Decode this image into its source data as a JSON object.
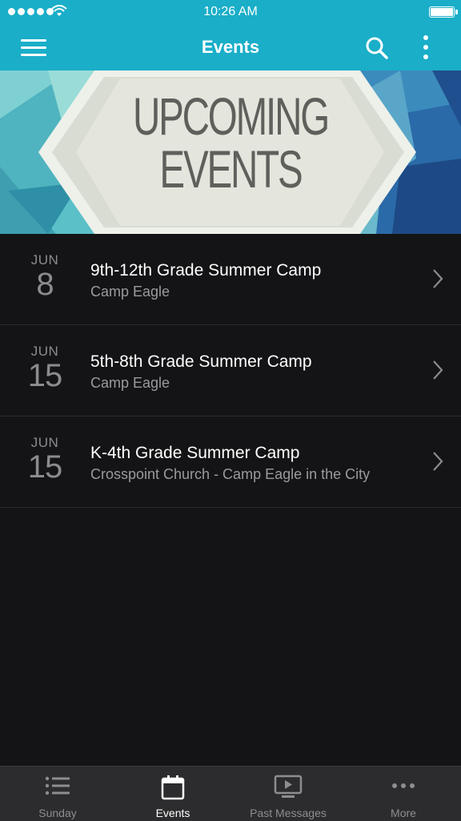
{
  "status_bar": {
    "time": "10:26 AM"
  },
  "nav": {
    "title": "Events"
  },
  "banner": {
    "line1": "UPCOMING",
    "line2": "EVENTS"
  },
  "events": [
    {
      "month": "JUN",
      "day": "8",
      "title": "9th-12th Grade Summer Camp",
      "location": "Camp Eagle"
    },
    {
      "month": "JUN",
      "day": "15",
      "title": "5th-8th Grade Summer Camp",
      "location": "Camp Eagle"
    },
    {
      "month": "JUN",
      "day": "15",
      "title": "K-4th Grade Summer Camp",
      "location": "Crosspoint Church - Camp Eagle in the City"
    }
  ],
  "tabs": [
    {
      "label": "Sunday",
      "icon": "list-icon"
    },
    {
      "label": "Events",
      "icon": "calendar-icon",
      "active": true
    },
    {
      "label": "Past Messages",
      "icon": "play-screen-icon"
    },
    {
      "label": "More",
      "icon": "more-dots-icon"
    }
  ],
  "colors": {
    "accent": "#1aaec8",
    "background": "#141416",
    "tabbar": "#2c2c2e"
  }
}
